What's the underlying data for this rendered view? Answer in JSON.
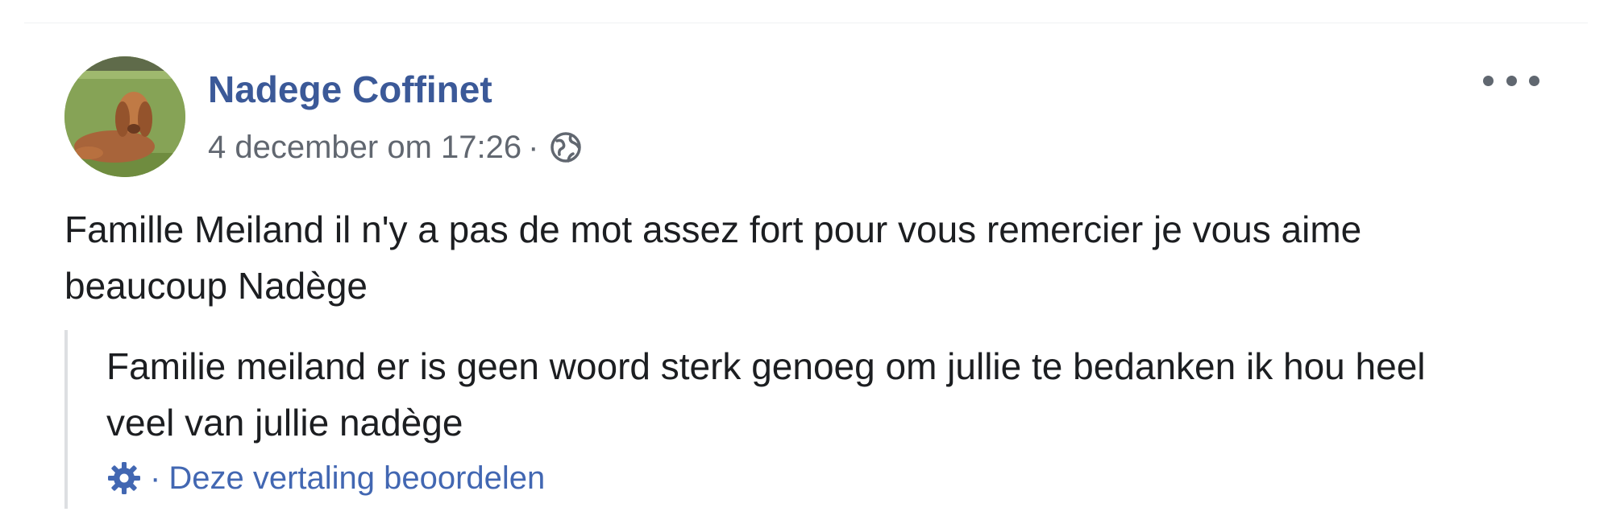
{
  "post": {
    "author": "Nadege Coffinet",
    "timestamp": "4 december om 17:26",
    "separator": "·",
    "privacy_icon": "globe-icon",
    "more_icon": "more-options-icon",
    "text": "Famille Meiland il n'y a pas de mot assez fort pour vous remercier je vous aime beaucoup Nadège",
    "translation": {
      "text": "Familie meiland er is geen woord sterk genoeg om jullie te bedanken ik hou heel veel van jullie nadège",
      "settings_icon": "gear-icon",
      "separator": "·",
      "rate_link": "Deze vertaling beoordelen"
    }
  },
  "colors": {
    "author_link": "#3b5998",
    "meta_text": "#616770",
    "body_text": "#1c1e21",
    "link_blue": "#4267b2",
    "quote_border": "#dddfe2"
  }
}
